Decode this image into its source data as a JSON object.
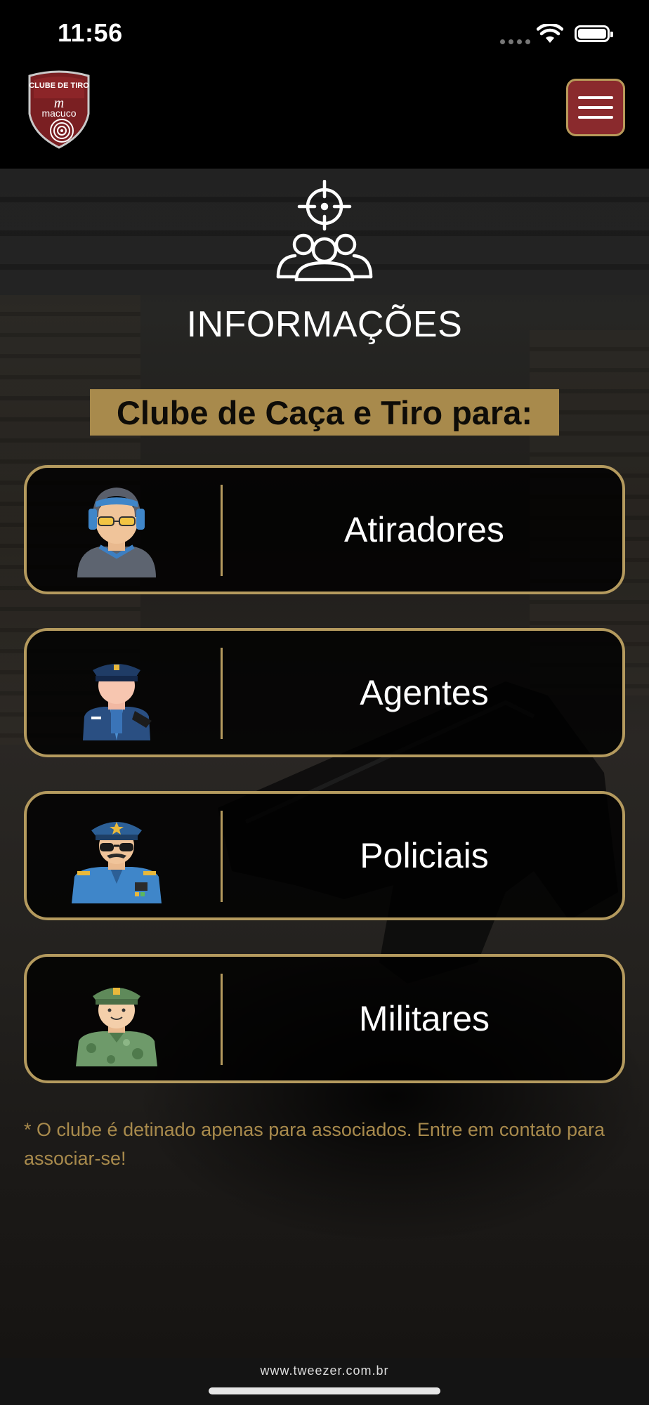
{
  "status_bar": {
    "time": "11:56"
  },
  "header": {
    "logo_text_top": "CLUBE DE TIRO",
    "logo_text_bottom": "macuco",
    "menu_icon": "hamburger-menu-icon"
  },
  "hero": {
    "icon": "target-group-icon",
    "title": "INFORMAÇÕES",
    "subtitle": "Clube de Caça e Tiro para:"
  },
  "categories": [
    {
      "label": "Atiradores",
      "icon": "shooter-avatar-icon"
    },
    {
      "label": "Agentes",
      "icon": "agent-avatar-icon"
    },
    {
      "label": "Policiais",
      "icon": "police-avatar-icon"
    },
    {
      "label": "Militares",
      "icon": "military-avatar-icon"
    }
  ],
  "note": "* O clube é detinado apenas para associados. Entre em contato para associar-se!",
  "footer": {
    "url": "www.tweezer.com.br"
  },
  "colors": {
    "gold": "#b49a5e",
    "menu_red": "#8a2a2d",
    "note_gold": "#a88a4c"
  }
}
